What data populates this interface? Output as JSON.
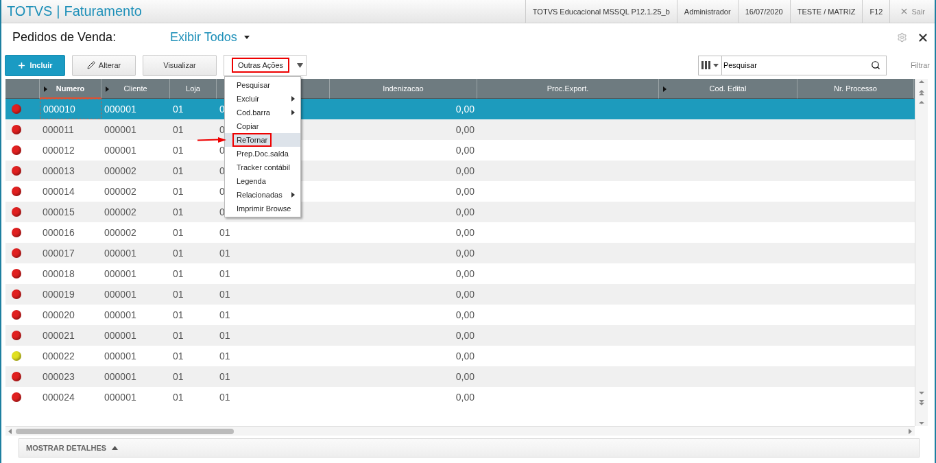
{
  "titlebar": {
    "brand": "TOTVS",
    "separator": "|",
    "module": "Faturamento",
    "info": [
      "TOTVS Educacional MSSQL P12.1.25_b",
      "Administrador",
      "16/07/2020",
      "TESTE / MATRIZ",
      "F12"
    ],
    "exit": "Sair"
  },
  "header": {
    "title": "Pedidos de Venda:",
    "filter": "Exibir Todos"
  },
  "toolbar": {
    "buttons": [
      {
        "label": "Incluir",
        "kind": "primary"
      },
      {
        "label": "Alterar",
        "kind": "edit"
      },
      {
        "label": "Visualizar",
        "kind": "plain"
      }
    ],
    "more": {
      "label": "Outras Ações",
      "annotated": true
    },
    "search": {
      "value": "Pesquisar"
    },
    "filter_link": "Filtrar"
  },
  "table": {
    "columns": [
      {
        "label": "Numero",
        "sortable": true,
        "selected": true
      },
      {
        "label": "Cliente",
        "sortable": true,
        "selected": false
      },
      {
        "label": "Loja",
        "sortable": false,
        "selected": false
      },
      {
        "sortable": false,
        "selected": false
      },
      {
        "label": "Indenizacao",
        "sortable": false,
        "selected": false
      },
      {
        "label": "Proc.Export.",
        "sortable": false,
        "selected": false
      },
      {
        "label": "Cod. Edital",
        "sortable": true,
        "selected": false
      },
      {
        "label": "Nr. Processo",
        "sortable": false,
        "selected": false
      }
    ],
    "rows": [
      {
        "color": "#e02020",
        "selected": true,
        "cells": [
          "000010",
          "000001",
          "01",
          "0",
          "0,00"
        ]
      },
      {
        "color": "#e02020",
        "selected": false,
        "cells": [
          "000011",
          "000001",
          "01",
          "0",
          "0,00"
        ]
      },
      {
        "color": "#e02020",
        "selected": false,
        "cells": [
          "000012",
          "000001",
          "01",
          "0",
          "0,00"
        ]
      },
      {
        "color": "#e02020",
        "selected": false,
        "cells": [
          "000013",
          "000002",
          "01",
          "0",
          "0,00"
        ]
      },
      {
        "color": "#e02020",
        "selected": false,
        "cells": [
          "000014",
          "000002",
          "01",
          "0",
          "0,00"
        ]
      },
      {
        "color": "#e02020",
        "selected": false,
        "cells": [
          "000015",
          "000002",
          "01",
          "0",
          "0,00"
        ]
      },
      {
        "color": "#e02020",
        "selected": false,
        "cells": [
          "000016",
          "000002",
          "01",
          "01",
          "0,00"
        ]
      },
      {
        "color": "#e02020",
        "selected": false,
        "cells": [
          "000017",
          "000001",
          "01",
          "01",
          "0,00"
        ]
      },
      {
        "color": "#e02020",
        "selected": false,
        "cells": [
          "000018",
          "000001",
          "01",
          "01",
          "0,00"
        ]
      },
      {
        "color": "#e02020",
        "selected": false,
        "cells": [
          "000019",
          "000001",
          "01",
          "01",
          "0,00"
        ]
      },
      {
        "color": "#e02020",
        "selected": false,
        "cells": [
          "000020",
          "000001",
          "01",
          "01",
          "0,00"
        ]
      },
      {
        "color": "#e02020",
        "selected": false,
        "cells": [
          "000021",
          "000001",
          "01",
          "01",
          "0,00"
        ]
      },
      {
        "color": "#e0e020",
        "selected": false,
        "cells": [
          "000022",
          "000001",
          "01",
          "01",
          "0,00"
        ]
      },
      {
        "color": "#e02020",
        "selected": false,
        "cells": [
          "000023",
          "000001",
          "01",
          "01",
          "0,00"
        ]
      },
      {
        "color": "#e02020",
        "selected": false,
        "cells": [
          "000024",
          "000001",
          "01",
          "01",
          "0,00"
        ]
      }
    ]
  },
  "menu": [
    {
      "label": "Pesquisar",
      "submenu": false,
      "selected": false,
      "annotated": false
    },
    {
      "label": "Excluir",
      "submenu": true,
      "selected": false,
      "annotated": false
    },
    {
      "label": "Cod.barra",
      "submenu": true,
      "selected": false,
      "annotated": false
    },
    {
      "label": "Copiar",
      "submenu": false,
      "selected": false,
      "annotated": false
    },
    {
      "label": "ReTornar",
      "submenu": false,
      "selected": true,
      "annotated": true
    },
    {
      "label": "Prep.Doc.saída",
      "submenu": false,
      "selected": false,
      "annotated": false
    },
    {
      "label": "Tracker contábil",
      "submenu": false,
      "selected": false,
      "annotated": false
    },
    {
      "label": "Legenda",
      "submenu": false,
      "selected": false,
      "annotated": false
    },
    {
      "label": "Relacionadas",
      "submenu": true,
      "selected": false,
      "annotated": false
    },
    {
      "label": "Imprimir Browse",
      "submenu": false,
      "selected": false,
      "annotated": false
    }
  ],
  "footer": {
    "details": "MOSTRAR DETALHES"
  }
}
